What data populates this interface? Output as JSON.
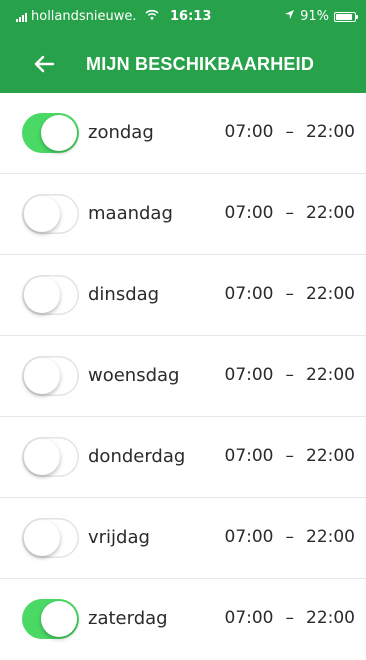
{
  "status_bar": {
    "carrier": "hollandsnieuwe.",
    "time": "16:13",
    "battery_percent": "91%",
    "battery_level": 0.91
  },
  "header": {
    "title": "MIJN BESCHIKBAARHEID",
    "color": "#27a24a"
  },
  "icons": {
    "back": "back-arrow-icon",
    "wifi": "wifi-icon",
    "location": "location-arrow-icon",
    "battery": "battery-icon",
    "signal": "signal-icon"
  },
  "toggle_on_color": "#4ad964",
  "days": [
    {
      "name": "zondag",
      "enabled": true,
      "start": "07:00",
      "separator": "–",
      "end": "22:00"
    },
    {
      "name": "maandag",
      "enabled": false,
      "start": "07:00",
      "separator": "–",
      "end": "22:00"
    },
    {
      "name": "dinsdag",
      "enabled": false,
      "start": "07:00",
      "separator": "–",
      "end": "22:00"
    },
    {
      "name": "woensdag",
      "enabled": false,
      "start": "07:00",
      "separator": "–",
      "end": "22:00"
    },
    {
      "name": "donderdag",
      "enabled": false,
      "start": "07:00",
      "separator": "–",
      "end": "22:00"
    },
    {
      "name": "vrijdag",
      "enabled": false,
      "start": "07:00",
      "separator": "–",
      "end": "22:00"
    },
    {
      "name": "zaterdag",
      "enabled": true,
      "start": "07:00",
      "separator": "–",
      "end": "22:00"
    }
  ]
}
